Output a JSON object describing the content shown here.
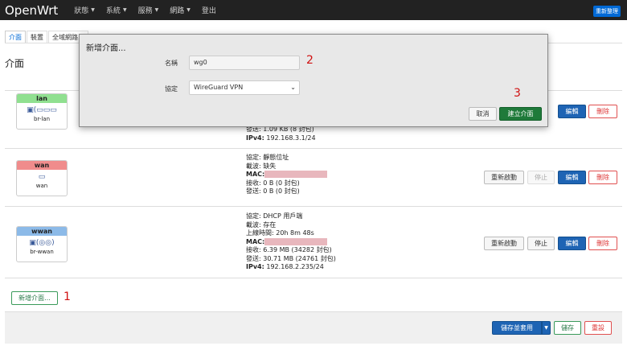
{
  "app": {
    "brand": "OpenWrt",
    "nav": [
      "狀態",
      "系統",
      "服務",
      "網路",
      "登出"
    ],
    "changes_badge": "重新整理"
  },
  "tabs": [
    "介面",
    "裝置",
    "全域網路..."
  ],
  "page_title": "介面",
  "interfaces": [
    {
      "name": "lan",
      "head_color": "#90e090",
      "device": "br-lan",
      "status_lines": [
        {
          "label": "發送:",
          "value": "1.09 KB (8 封包)"
        },
        {
          "label": "IPv4:",
          "value": "192.168.3.1/24",
          "bold": true
        }
      ],
      "actions": [
        "編輯",
        "刪除"
      ]
    },
    {
      "name": "wan",
      "head_color": "#f08c8c",
      "device": "wan",
      "status_lines": [
        {
          "label": "協定:",
          "value": "靜態位址"
        },
        {
          "label": "載波:",
          "value": "缺失"
        },
        {
          "label": "MAC:",
          "value": "",
          "bold": true,
          "redacted": true
        },
        {
          "label": "接收:",
          "value": "0 B (0 封包)"
        },
        {
          "label": "發送:",
          "value": "0 B (0 封包)"
        }
      ],
      "actions": [
        "重新啟動",
        "停止",
        "編輯",
        "刪除"
      ]
    },
    {
      "name": "wwan",
      "head_color": "#8cbae8",
      "device": "br-wwan",
      "status_lines": [
        {
          "label": "協定:",
          "value": "DHCP 用戶端"
        },
        {
          "label": "載波:",
          "value": "存在"
        },
        {
          "label": "上線時間:",
          "value": "20h 8m 48s"
        },
        {
          "label": "MAC:",
          "value": "",
          "bold": true,
          "redacted": true
        },
        {
          "label": "接收:",
          "value": "6.39 MB (34282 封包)"
        },
        {
          "label": "發送:",
          "value": "30.71 MB (24761 封包)"
        },
        {
          "label": "IPv4:",
          "value": "192.168.2.235/24",
          "bold": true
        }
      ],
      "actions": [
        "重新啟動",
        "停止",
        "編輯",
        "刪除"
      ]
    }
  ],
  "add_interface_button": "新增介面...",
  "footer": {
    "save_apply": "儲存並套用",
    "save": "儲存",
    "reset": "重設"
  },
  "modal": {
    "title": "新增介面...",
    "name_label": "名稱",
    "name_value": "wg0",
    "protocol_label": "協定",
    "protocol_value": "WireGuard VPN",
    "cancel": "取消",
    "create": "建立介面"
  },
  "annotations": [
    "1",
    "2",
    "3"
  ]
}
